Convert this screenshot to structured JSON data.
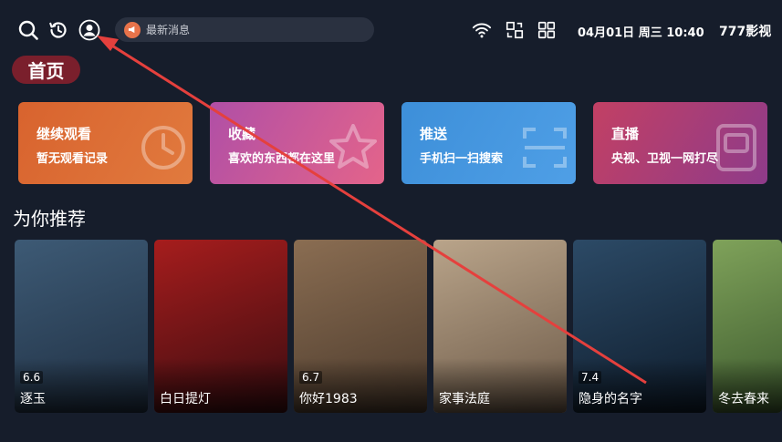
{
  "topbar": {
    "news_text": "最新消息",
    "datetime": "04月01日 周三 10:40",
    "brand": "777影视"
  },
  "nav": {
    "home_tab": "首页"
  },
  "cards": [
    {
      "title": "继续观看",
      "subtitle": "暂无观看记录",
      "icon": "history-clock-icon",
      "color_from": "#d8632e",
      "color_to": "#e17a3e"
    },
    {
      "title": "收藏",
      "subtitle": "喜欢的东西都在这里",
      "icon": "star-icon",
      "color_from": "#b04fa6",
      "color_to": "#e4648a"
    },
    {
      "title": "推送",
      "subtitle": "手机扫一扫搜索",
      "icon": "scan-icon",
      "color_from": "#3d8fd9",
      "color_to": "#4f9fe6"
    },
    {
      "title": "直播",
      "subtitle": "央视、卫视一网打尽",
      "icon": "tv-icon",
      "color_from": "#c24064",
      "color_to": "#8e3b8a"
    }
  ],
  "section": {
    "title": "为你推荐"
  },
  "posters": [
    {
      "name": "逐玉",
      "rating": "6.6",
      "colors": [
        "#3d5a75",
        "#1f2f42"
      ]
    },
    {
      "name": "白日提灯",
      "rating": "",
      "colors": [
        "#a61d1d",
        "#3a0c10"
      ]
    },
    {
      "name": "你好1983",
      "rating": "6.7",
      "colors": [
        "#8a6d52",
        "#4b3a2c"
      ]
    },
    {
      "name": "家事法庭",
      "rating": "",
      "colors": [
        "#b9a48a",
        "#6d5a48"
      ]
    },
    {
      "name": "隐身的名字",
      "rating": "7.4",
      "colors": [
        "#2c4a66",
        "#0e1c2c"
      ]
    },
    {
      "name": "冬去春来",
      "rating": "",
      "colors": [
        "#7fa25a",
        "#3d5a2e"
      ]
    }
  ],
  "annotation_color": "#e5403d"
}
